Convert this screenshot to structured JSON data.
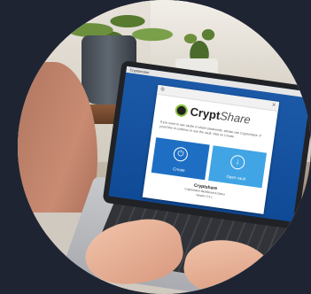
{
  "app": {
    "brand_main": "Crypt",
    "brand_sub": "Share",
    "intro_text": "If you want to use vaults or share passwords, please use Cryptomator. If you'd like to continue to use the vault, click on Create.",
    "tiles": [
      {
        "label": "Create",
        "icon": "power-icon"
      },
      {
        "label": "Open vault",
        "icon": "download-icon"
      }
    ],
    "footer_logo": "Cryptshare",
    "footer_line1": "Cryptomator dashboard & Demo",
    "footer_line2": "Version 2.4.1"
  },
  "menubar": {
    "label": "Cryptomator"
  }
}
